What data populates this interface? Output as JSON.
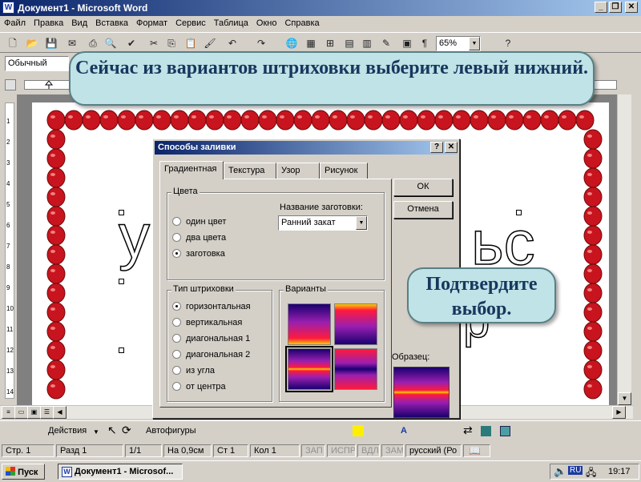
{
  "window": {
    "title": "Документ1 - Microsoft Word"
  },
  "menu": [
    "Файл",
    "Правка",
    "Вид",
    "Вставка",
    "Формат",
    "Сервис",
    "Таблица",
    "Окно",
    "Справка"
  ],
  "toolbar": {
    "zoom": "65%",
    "style": "Обычный"
  },
  "vruler_marks": [
    "1",
    "2",
    "3",
    "4",
    "5",
    "6",
    "7",
    "8",
    "9",
    "10",
    "11",
    "12",
    "13",
    "14"
  ],
  "document": {
    "letter_left": "у",
    "letters_right": "ьс",
    "letter_lower": "р"
  },
  "callouts": {
    "top": "Сейчас из вариантов штриховки выберите левый нижний.",
    "right": "Подтвердите выбор."
  },
  "dialog": {
    "title": "Способы заливки",
    "help_btn": "?",
    "close_btn": "✕",
    "tabs": [
      "Градиентная",
      "Текстура",
      "Узор",
      "Рисунок"
    ],
    "colors": {
      "label": "Цвета",
      "options": [
        "один цвет",
        "два цвета",
        "заготовка"
      ],
      "selected": 2,
      "preset_label": "Название заготовки:",
      "preset_value": "Ранний закат"
    },
    "shading": {
      "label": "Тип штриховки",
      "options": [
        "горизонтальная",
        "вертикальная",
        "диагональная 1",
        "диагональная 2",
        "из угла",
        "от центра"
      ],
      "selected": 0
    },
    "variants": {
      "label": "Варианты",
      "selected": 2
    },
    "ok": "ОК",
    "cancel": "Отмена",
    "sample_label": "Образец:"
  },
  "colors": {
    "preset_dark": "#1a0070",
    "preset_mid": "#9a1fb0",
    "preset_red": "#ff1a3c",
    "preset_yellow": "#ffcc00"
  },
  "drawbar": {
    "actions": "Действия",
    "autoshapes": "Автофигуры"
  },
  "status": {
    "page": "Стр. 1",
    "section": "Разд 1",
    "pages": "1/1",
    "position": "На 0,9см",
    "line": "Ст 1",
    "column": "Кол 1",
    "rec": "ЗАП",
    "trk": "ИСПР",
    "ext": "ВДЛ",
    "ovr": "ЗАМ",
    "lang": "русский (Ро"
  },
  "taskbar": {
    "start": "Пуск",
    "task": "Документ1 - Microsof...",
    "lang": "RU",
    "time": "19:17"
  }
}
